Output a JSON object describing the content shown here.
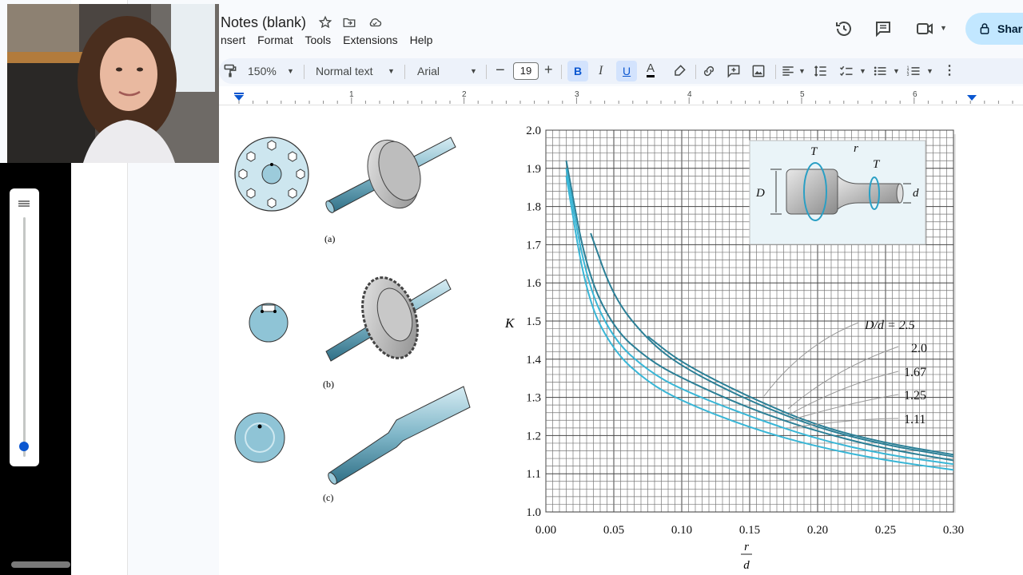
{
  "doc": {
    "title": "Notes (blank)",
    "menu": [
      "nsert",
      "Format",
      "Tools",
      "Extensions",
      "Help"
    ],
    "share_label": "Shar"
  },
  "toolbar": {
    "zoom": "150%",
    "style": "Normal text",
    "font": "Arial",
    "font_size": "19"
  },
  "ruler": {
    "marks": [
      "1",
      "2",
      "3",
      "4",
      "5",
      "6"
    ]
  },
  "figure": {
    "captions": [
      "(a)",
      "(b)",
      "(c)"
    ]
  },
  "chart_data": {
    "type": "line",
    "x": [
      0.015,
      0.03,
      0.05,
      0.075,
      0.1,
      0.15,
      0.2,
      0.25,
      0.3
    ],
    "xlabel_top": "r",
    "xlabel_bottom": "d",
    "ylabel": "K",
    "xlim": [
      0.0,
      0.3
    ],
    "ylim": [
      1.0,
      2.0
    ],
    "x_ticks": [
      "0.00",
      "0.05",
      "0.10",
      "0.15",
      "0.20",
      "0.25",
      "0.30"
    ],
    "y_ticks": [
      "1.0",
      "1.1",
      "1.2",
      "1.3",
      "1.4",
      "1.5",
      "1.6",
      "1.7",
      "1.8",
      "1.9",
      "2.0"
    ],
    "grid": true,
    "series": [
      {
        "name": "D/d = 2.5",
        "points": [
          [
            0.075,
            1.46
          ],
          [
            0.1,
            1.39
          ],
          [
            0.15,
            1.3
          ],
          [
            0.2,
            1.225
          ],
          [
            0.25,
            1.18
          ],
          [
            0.3,
            1.15
          ]
        ]
      },
      {
        "name": "2.0",
        "points": [
          [
            0.033,
            1.73
          ],
          [
            0.05,
            1.56
          ],
          [
            0.075,
            1.45
          ],
          [
            0.1,
            1.38
          ],
          [
            0.15,
            1.29
          ],
          [
            0.2,
            1.22
          ],
          [
            0.25,
            1.175
          ],
          [
            0.3,
            1.145
          ]
        ]
      },
      {
        "name": "1.67",
        "points": [
          [
            0.015,
            1.92
          ],
          [
            0.03,
            1.63
          ],
          [
            0.05,
            1.48
          ],
          [
            0.075,
            1.4
          ],
          [
            0.1,
            1.35
          ],
          [
            0.15,
            1.27
          ],
          [
            0.2,
            1.21
          ],
          [
            0.25,
            1.165
          ],
          [
            0.3,
            1.135
          ]
        ]
      },
      {
        "name": "1.25",
        "points": [
          [
            0.015,
            1.9
          ],
          [
            0.03,
            1.6
          ],
          [
            0.05,
            1.45
          ],
          [
            0.075,
            1.37
          ],
          [
            0.1,
            1.32
          ],
          [
            0.15,
            1.25
          ],
          [
            0.2,
            1.19
          ],
          [
            0.25,
            1.15
          ],
          [
            0.3,
            1.125
          ]
        ]
      },
      {
        "name": "1.11",
        "points": [
          [
            0.015,
            1.88
          ],
          [
            0.03,
            1.56
          ],
          [
            0.05,
            1.42
          ],
          [
            0.075,
            1.34
          ],
          [
            0.1,
            1.29
          ],
          [
            0.15,
            1.22
          ],
          [
            0.2,
            1.17
          ],
          [
            0.25,
            1.135
          ],
          [
            0.3,
            1.11
          ]
        ]
      }
    ],
    "inset_labels": [
      "T",
      "r",
      "T",
      "D",
      "d"
    ]
  },
  "colors": {
    "accent": "#0b57d0",
    "share_bg": "#c2e7ff",
    "curve": "#39b6d6",
    "curve_dark": "#2b7f96"
  }
}
